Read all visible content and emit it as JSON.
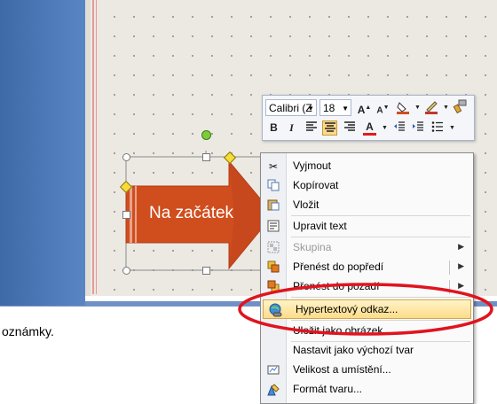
{
  "notes": {
    "text": "oznámky."
  },
  "slide": {
    "arrow_text": "Na začátek",
    "arrow_fill": "#d04e1e"
  },
  "mini_toolbar": {
    "font_name": "Calibri (Z",
    "font_size": "18",
    "buttons": [
      "grow-font",
      "shrink-font",
      "fill-color",
      "line-color",
      "format-painter",
      "bold",
      "italic",
      "align-left",
      "align-center",
      "align-right",
      "font-color",
      "decrease-indent",
      "increase-indent",
      "bullets"
    ]
  },
  "context_menu": {
    "items": [
      {
        "label": "Vyjmout",
        "icon": "scissors-icon"
      },
      {
        "label": "Kopírovat",
        "icon": "copy-icon"
      },
      {
        "label": "Vložit",
        "icon": "paste-icon"
      },
      {
        "label": "Upravit text",
        "icon": "edit-text-icon"
      },
      {
        "label": "Skupina",
        "icon": "group-icon",
        "disabled": true,
        "submenu": true
      },
      {
        "label": "Přenést do popředí",
        "icon": "bring-front-icon",
        "submenu": true
      },
      {
        "label": "Přenést do pozadí",
        "icon": "send-back-icon",
        "submenu": true
      },
      {
        "label": "Hypertextový odkaz...",
        "icon": "hyperlink-icon",
        "highlighted": true
      },
      {
        "label": "Uložit jako obrázek...",
        "icon": "save-picture-icon"
      },
      {
        "label": "Nastavit jako výchozí tvar",
        "icon": "default-shape-icon"
      },
      {
        "label": "Velikost a umístění...",
        "icon": "size-position-icon"
      },
      {
        "label": "Formát tvaru...",
        "icon": "format-shape-icon"
      }
    ]
  },
  "annotation_color": "#e0141e"
}
